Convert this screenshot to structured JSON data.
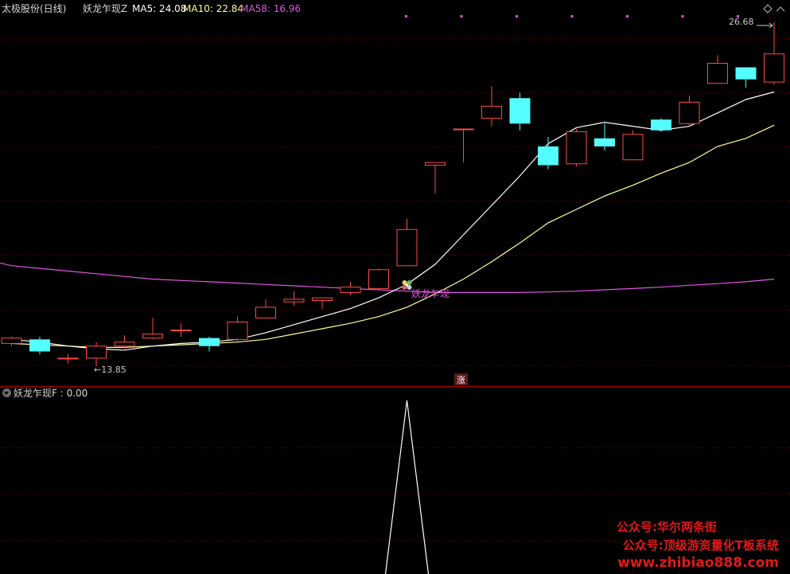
{
  "header": {
    "stock_label": "太极股份(日线)",
    "indicator_name": "妖龙乍现Z",
    "ma5": "MA5: 24.08",
    "ma10": "MA10: 22.84",
    "ma58": "MA58: 16.96"
  },
  "main_chart": {
    "high_label": "26.68",
    "low_label": "←13.85",
    "signal_text": "妖龙乍现",
    "zhang_badge": "涨"
  },
  "sub_panel": {
    "label": "妖龙乍现F : 0.00"
  },
  "watermark": {
    "line1": "公众号:华尔两条街",
    "line2": "公众号:顶级游资量化T板系统",
    "line3": "www.zhibiao888.com"
  },
  "colors": {
    "background": "#000000",
    "up_candle": "#ff4a4a",
    "down_candle": "#54ffff",
    "ma5": "#ffffff",
    "ma10": "#ffff96",
    "ma58": "#e254e2",
    "grid": "#7a0000",
    "watermark": "#e21818"
  },
  "chart_data": {
    "type": "candlestick",
    "price_range": [
      13.5,
      27.2
    ],
    "candles": [
      {
        "o": 14.7,
        "c": 14.9,
        "h": 14.95,
        "l": 14.6
      },
      {
        "o": 14.85,
        "c": 14.4,
        "h": 14.95,
        "l": 14.3
      },
      {
        "o": 14.15,
        "c": 14.15,
        "h": 14.3,
        "l": 13.95
      },
      {
        "o": 14.15,
        "c": 14.6,
        "h": 14.75,
        "l": 13.85
      },
      {
        "o": 14.6,
        "c": 14.75,
        "h": 15.0,
        "l": 14.5
      },
      {
        "o": 14.9,
        "c": 15.05,
        "h": 15.65,
        "l": 14.85
      },
      {
        "o": 15.2,
        "c": 15.2,
        "h": 15.45,
        "l": 14.95
      },
      {
        "o": 14.9,
        "c": 14.6,
        "h": 14.95,
        "l": 14.4
      },
      {
        "o": 14.85,
        "c": 15.5,
        "h": 15.7,
        "l": 14.75
      },
      {
        "o": 15.65,
        "c": 16.05,
        "h": 16.35,
        "l": 15.65
      },
      {
        "o": 16.25,
        "c": 16.35,
        "h": 16.65,
        "l": 16.1
      },
      {
        "o": 16.3,
        "c": 16.4,
        "h": 16.4,
        "l": 16.0
      },
      {
        "o": 16.6,
        "c": 16.8,
        "h": 17.0,
        "l": 16.5
      },
      {
        "o": 16.75,
        "c": 17.45,
        "h": 17.5,
        "l": 16.7
      },
      {
        "o": 17.6,
        "c": 18.95,
        "h": 19.35,
        "l": 17.6
      },
      {
        "o": 21.35,
        "c": 21.45,
        "h": 21.45,
        "l": 20.3
      },
      {
        "o": 22.7,
        "c": 22.7,
        "h": 22.7,
        "l": 21.45
      },
      {
        "o": 23.1,
        "c": 23.55,
        "h": 24.3,
        "l": 22.8
      },
      {
        "o": 23.85,
        "c": 22.9,
        "h": 24.05,
        "l": 22.65
      },
      {
        "o": 22.05,
        "c": 21.35,
        "h": 22.4,
        "l": 21.2
      },
      {
        "o": 21.4,
        "c": 22.6,
        "h": 22.7,
        "l": 21.3
      },
      {
        "o": 22.35,
        "c": 22.05,
        "h": 22.9,
        "l": 21.9
      },
      {
        "o": 21.55,
        "c": 22.5,
        "h": 22.65,
        "l": 21.55
      },
      {
        "o": 23.05,
        "c": 22.65,
        "h": 23.1,
        "l": 22.6
      },
      {
        "o": 22.9,
        "c": 23.7,
        "h": 23.95,
        "l": 22.8
      },
      {
        "o": 24.4,
        "c": 25.15,
        "h": 25.45,
        "l": 24.4
      },
      {
        "o": 25.0,
        "c": 24.55,
        "h": 25.0,
        "l": 24.25
      },
      {
        "o": 24.45,
        "c": 25.5,
        "h": 26.68,
        "l": 24.35
      }
    ],
    "ma5": [
      14.85,
      14.75,
      14.6,
      14.5,
      14.45,
      14.6,
      14.7,
      14.75,
      14.85,
      15.1,
      15.4,
      15.7,
      16.0,
      16.4,
      16.9,
      17.65,
      18.75,
      19.85,
      20.95,
      22.15,
      22.75,
      22.95,
      22.8,
      22.65,
      22.8,
      23.3,
      23.8,
      24.08
    ],
    "ma10": [
      14.7,
      14.65,
      14.6,
      14.55,
      14.55,
      14.6,
      14.65,
      14.7,
      14.75,
      14.85,
      15.05,
      15.25,
      15.45,
      15.7,
      16.05,
      16.55,
      17.1,
      17.75,
      18.45,
      19.2,
      19.7,
      20.2,
      20.6,
      21.05,
      21.45,
      22.05,
      22.35,
      22.84
    ],
    "ma58": [
      17.6,
      17.5,
      17.4,
      17.3,
      17.2,
      17.1,
      17.05,
      17.0,
      16.95,
      16.9,
      16.85,
      16.8,
      16.75,
      16.7,
      16.65,
      16.6,
      16.6,
      16.6,
      16.6,
      16.62,
      16.65,
      16.7,
      16.75,
      16.8,
      16.87,
      16.93,
      17.0,
      17.1
    ],
    "ma58_prefix": [
      17.7
    ],
    "signal_index": 14,
    "sub_panel": {
      "type": "line",
      "spike_index": 14,
      "values": [
        0,
        0,
        0,
        0,
        0,
        0,
        0,
        0,
        0,
        0,
        0,
        0,
        0,
        0,
        1,
        0,
        0,
        0,
        0,
        0,
        0,
        0,
        0,
        0,
        0,
        0,
        0,
        0
      ]
    }
  }
}
